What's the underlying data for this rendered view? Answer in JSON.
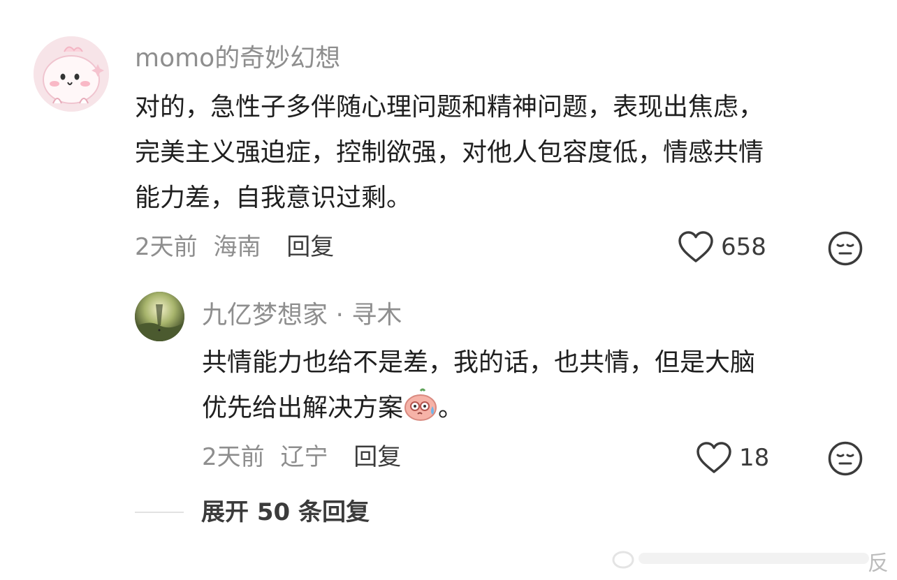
{
  "comment": {
    "username": "momo的奇妙幻想",
    "text_lines": [
      "对的，急性子多伴随心理问题和精神问题，表现出焦虑，",
      "完美主义强迫症，控制欲强，对他人包容度低，情感共情",
      "能力差，自我意识过剩。"
    ],
    "time": "2天前",
    "location": "海南",
    "reply_label": "回复",
    "likes": "658",
    "avatar_icon": "pink-cartoon-avatar",
    "like_icon": "heart-outline-icon",
    "dislike_icon": "meh-face-icon"
  },
  "reply": {
    "username": "九亿梦想家 · 寻木",
    "line1": "共情能力也给不是差，我的话，也共情，但是大脑",
    "line2_text": "优先给出解决方案",
    "line2_emoji": "sweat-face-emoji",
    "line2_tail": "。",
    "time": "2天前",
    "location": "辽宁",
    "reply_label": "回复",
    "likes": "18",
    "avatar_icon": "forest-landscape-avatar"
  },
  "expand": {
    "label": "展开 50 条回复"
  },
  "watermark": {
    "text": "反"
  }
}
